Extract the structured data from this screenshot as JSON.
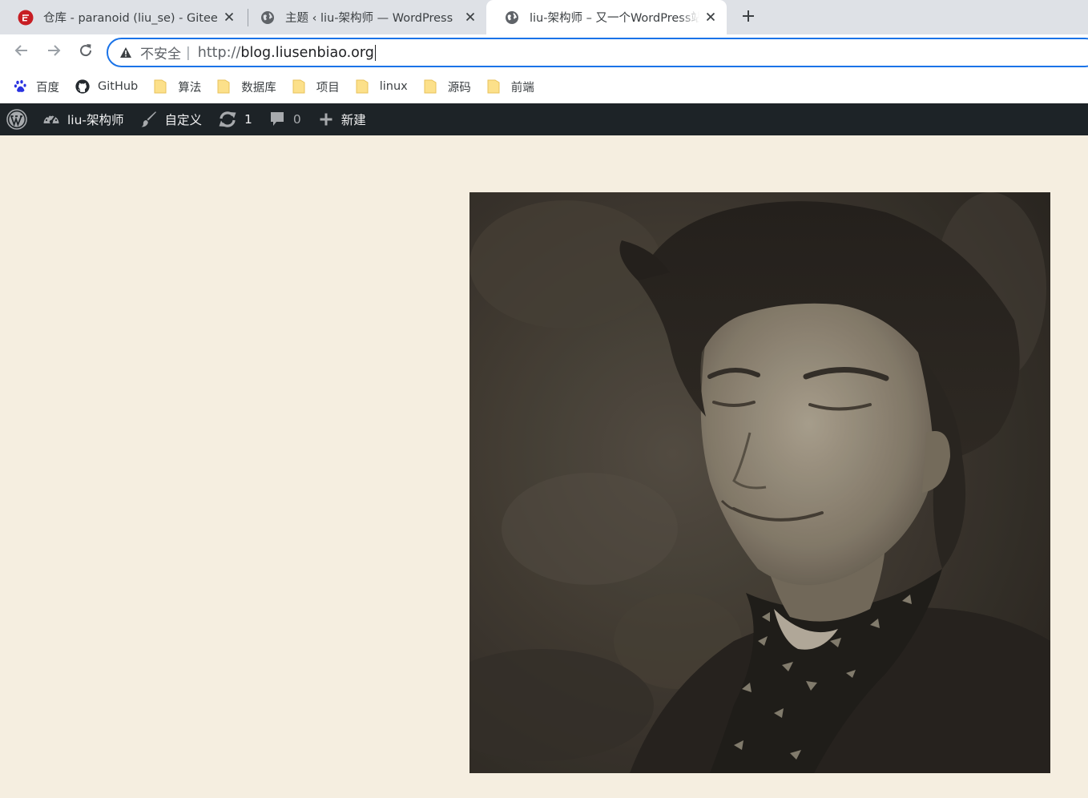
{
  "browser": {
    "tabs": [
      {
        "title": "仓库 - paranoid (liu_se) - Gitee",
        "favicon": "gitee-logo-icon",
        "active": false
      },
      {
        "title": "主题 ‹ liu-架构师 — WordPress",
        "favicon": "globe-icon",
        "active": false
      },
      {
        "title": "liu-架构师 – 又一个WordPress站点",
        "favicon": "globe-icon",
        "active": true
      }
    ],
    "new_tab_icon": "plus-icon",
    "address_bar": {
      "security_label": "不安全",
      "separator": "|",
      "scheme": "http://",
      "host": "blog.liusenbiao.org"
    },
    "bookmarks": [
      {
        "label": "百度",
        "icon": "baidu-paw-icon"
      },
      {
        "label": "GitHub",
        "icon": "github-icon"
      },
      {
        "label": "算法",
        "icon": "folder-icon"
      },
      {
        "label": "数据库",
        "icon": "folder-icon"
      },
      {
        "label": "项目",
        "icon": "folder-icon"
      },
      {
        "label": "linux",
        "icon": "folder-icon"
      },
      {
        "label": "源码",
        "icon": "folder-icon"
      },
      {
        "label": "前端",
        "icon": "folder-icon"
      }
    ]
  },
  "admin_bar": {
    "wp_logo_icon": "wordpress-logo-icon",
    "site_name": "liu-架构师",
    "customize_label": "自定义",
    "updates_count": "1",
    "comments_count": "0",
    "new_label": "新建"
  },
  "page": {
    "hero_image": "sepia-portrait-photo",
    "colors": {
      "background": "#f5eee0",
      "admin_bar": "#1d2327",
      "omnibox_focus": "#1a73e8"
    }
  }
}
